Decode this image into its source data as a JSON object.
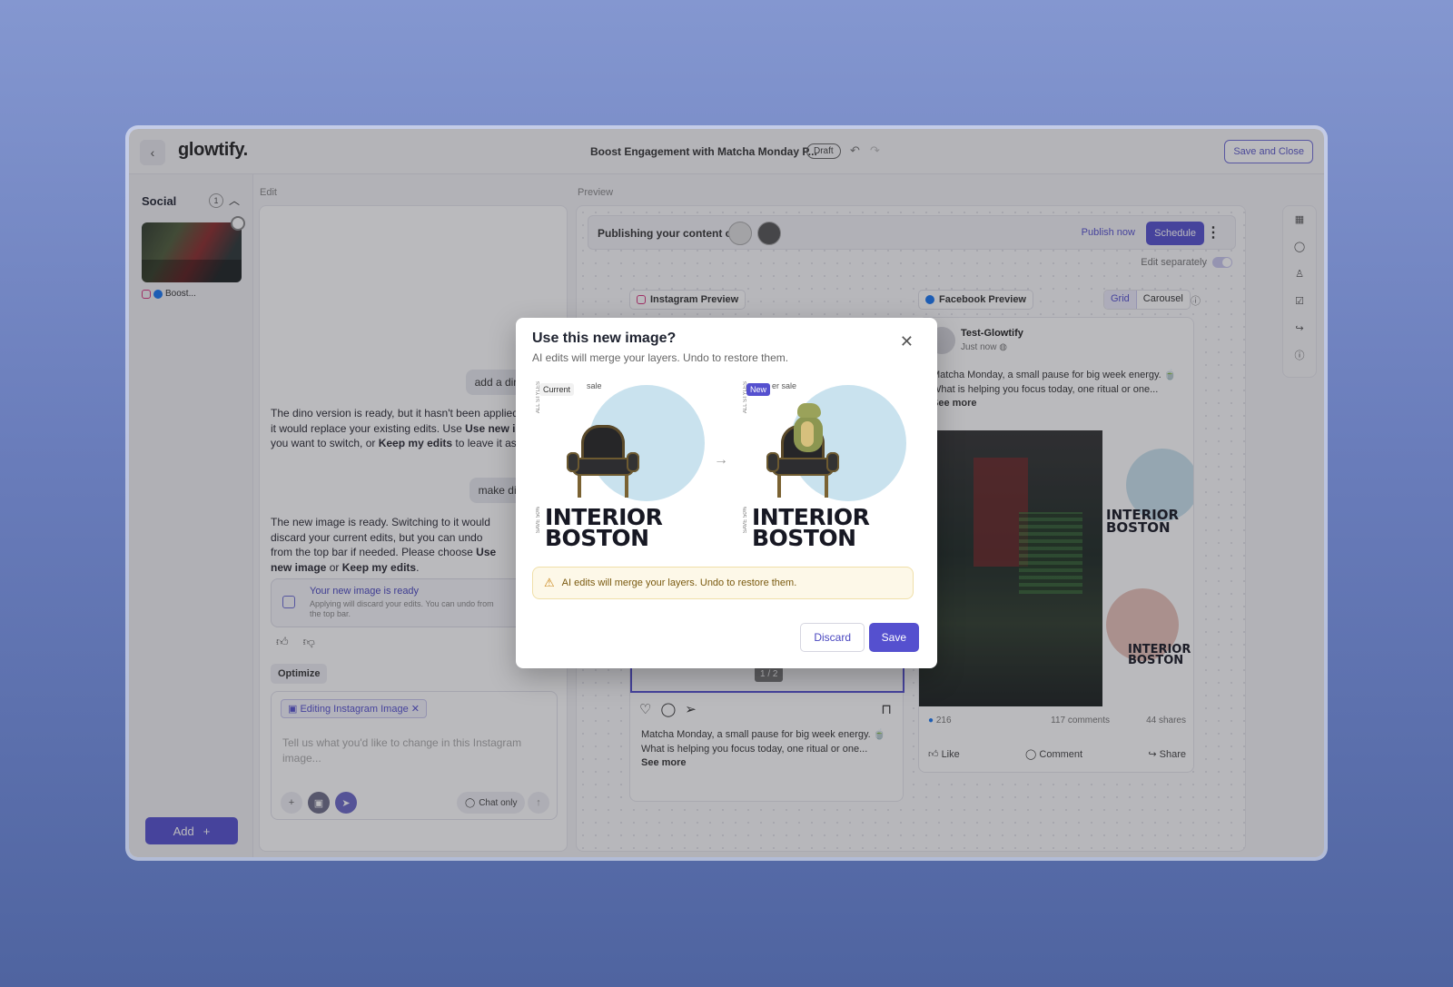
{
  "topbar": {
    "logo": "glowtify.",
    "doc_title": "Boost Engagement with Matcha Monday P...",
    "status": "Draft",
    "save_close_label": "Save and Close"
  },
  "sidebar": {
    "section_title": "Social",
    "section_count": "1",
    "item_caption": "Boost...",
    "add_label": "Add"
  },
  "edit": {
    "panel_label": "Edit",
    "user_msg_1": "add a dino to this",
    "ai_msg_1_part1": "The dino version is ready, but it hasn't been applied because it would replace your existing edits. Use ",
    "ai_msg_1_bold1": "Use new image",
    "ai_msg_1_part2": " if you want to switch, or ",
    "ai_msg_1_bold2": "Keep my edits",
    "ai_msg_1_part3": " to leave it as is.",
    "user_msg_2": "make dino sit on",
    "ai_msg_2_part1": "The new image is ready. Switching to it would discard your current edits, but you can undo from the top bar if needed. Please choose ",
    "ai_msg_2_bold1": "Use new image",
    "ai_msg_2_part2": " or ",
    "ai_msg_2_bold2": "Keep my edits",
    "ai_msg_2_part3": ".",
    "ready_title": "Your new image is ready",
    "ready_sub": "Applying will discard your edits. You can undo from the top bar.",
    "optimize_label": "Optimize",
    "chip_label": "Editing Instagram Image",
    "composer_placeholder": "Tell us what you'd like to change in this Instagram image...",
    "chat_only_label": "Chat only"
  },
  "preview": {
    "panel_label": "Preview",
    "publishing_label": "Publishing your content on",
    "publish_now_label": "Publish now",
    "schedule_label": "Schedule",
    "edit_separately_label": "Edit separately",
    "instagram_tab": "Instagram Preview",
    "facebook_tab": "Facebook Preview",
    "grid_label": "Grid",
    "carousel_label": "Carousel",
    "ig_pager": "1 / 2",
    "ig_caption": "Matcha Monday, a small pause for big week energy. 🍵 What is helping you focus today, one ritual or one...",
    "see_more": "See more",
    "fb_name": "Test-Glowtify",
    "fb_time": "Just now",
    "fb_text": "Matcha Monday, a small pause for big week energy. 🍵 What is helping you focus today, one ritual or one...",
    "fb_likes": "216",
    "fb_comments": "117 comments",
    "fb_shares": "44 shares",
    "like_label": "Like",
    "comment_label": "Comment",
    "share_label": "Share",
    "fb_img_headline_1": "INTERIOR BOSTON",
    "fb_img_headline_2": "INTERIOR BOSTON"
  },
  "modal": {
    "title": "Use this new image?",
    "subtitle": "AI edits will merge your layers. Undo to restore them.",
    "current_tag": "Current",
    "new_tag": "New",
    "image_small_text_left": "sale",
    "image_small_text_right": "er sale",
    "image_side_text": "ALL STYLES",
    "image_side_text_2": "SAVE 50%",
    "headline_line1": "INTERIOR",
    "headline_line2": "BOSTON",
    "warning": "AI edits will merge your layers. Undo to restore them.",
    "discard_label": "Discard",
    "save_label": "Save"
  },
  "colors": {
    "accent": "#5550cf",
    "warning_bg": "#fdf8e8",
    "circle": "#c9e2ee"
  }
}
